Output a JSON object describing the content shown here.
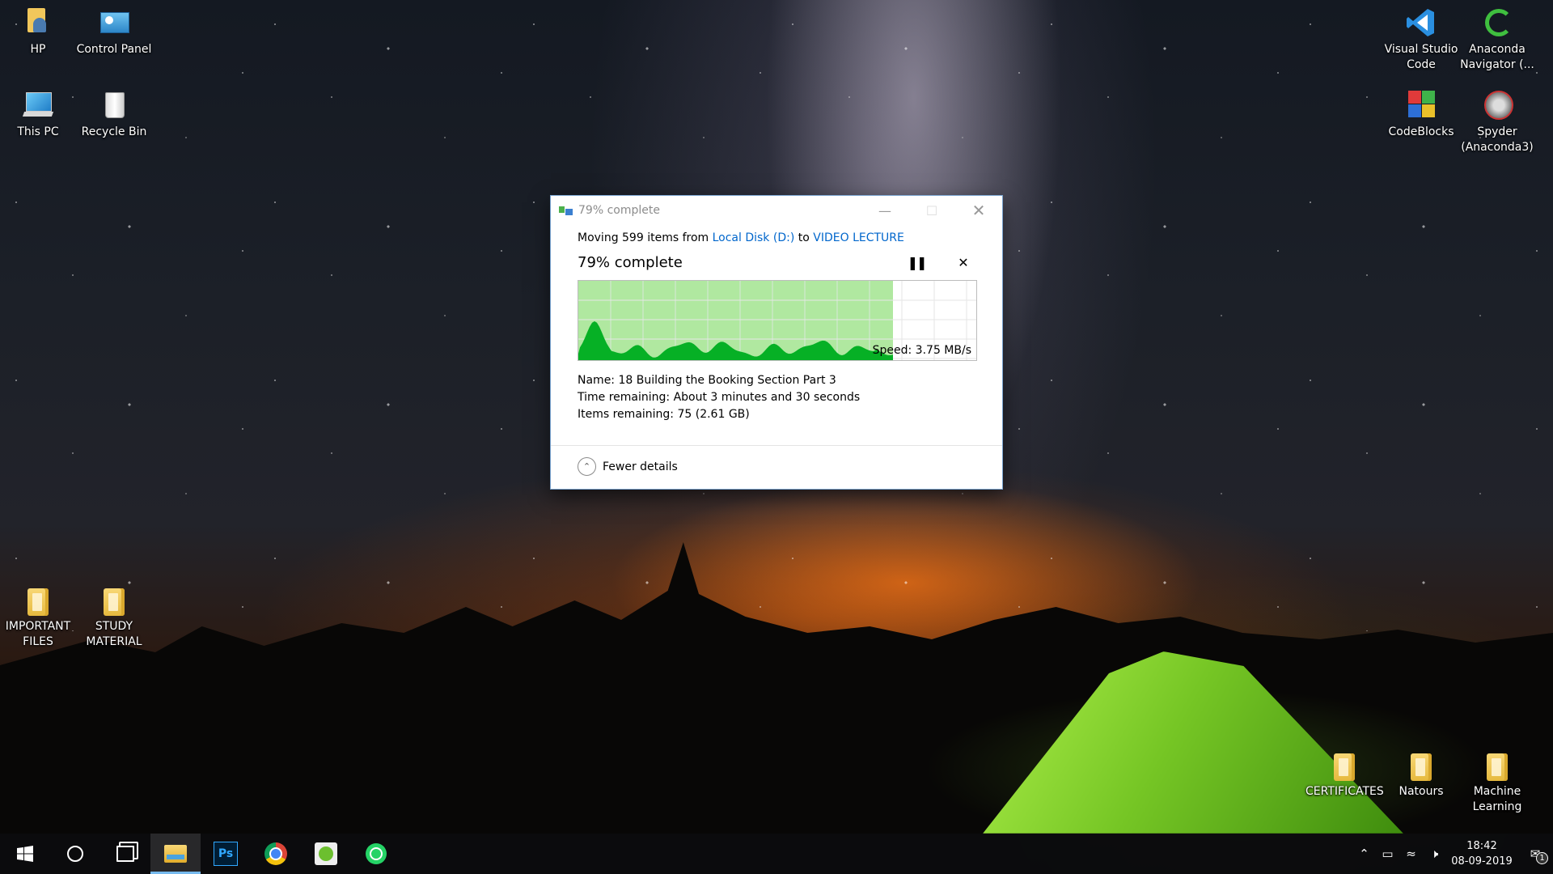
{
  "desktop": {
    "icons": [
      {
        "label": "HP"
      },
      {
        "label": "Control Panel"
      },
      {
        "label": "This PC"
      },
      {
        "label": "Recycle Bin"
      },
      {
        "label": "Visual Studio Code"
      },
      {
        "label": "Anaconda Navigator (..."
      },
      {
        "label": "CodeBlocks"
      },
      {
        "label": "Spyder (Anaconda3)"
      },
      {
        "label": "IMPORTANT FILES"
      },
      {
        "label": "STUDY MATERIAL"
      },
      {
        "label": "CERTIFICATES"
      },
      {
        "label": "Natours"
      },
      {
        "label": "Machine Learning"
      }
    ]
  },
  "dialog": {
    "title": "79% complete",
    "moving_prefix": "Moving 599 items from",
    "source": "Local Disk (D:)",
    "to_word": "to",
    "destination": "VIDEO LECTURE",
    "percent_text": "79% complete",
    "progress_fraction": 0.79,
    "speed_text": "Speed: 3.75 MB/s",
    "name_text": "Name:  18  Building the Booking Section   Part 3",
    "time_remaining_text": "Time remaining:  About 3 minutes and 30 seconds",
    "items_remaining_text": "Items remaining:  75 (2.61 GB)",
    "fewer_details": "Fewer details",
    "pause_icon": "pause-icon",
    "cancel_icon": "close-icon",
    "colors": {
      "graph_bg": "#b0e8a0",
      "graph_fill": "#06b025",
      "link": "#0066cc"
    }
  },
  "taskbar": {
    "apps": [
      "start-icon",
      "search-circle-icon",
      "task-view-icon",
      "file-explorer-icon",
      "photoshop-icon",
      "chrome-icon",
      "app-icon",
      "whatsapp-icon"
    ],
    "clock_time": "18:42",
    "clock_date": "08-09-2019",
    "notification_count": "1"
  }
}
